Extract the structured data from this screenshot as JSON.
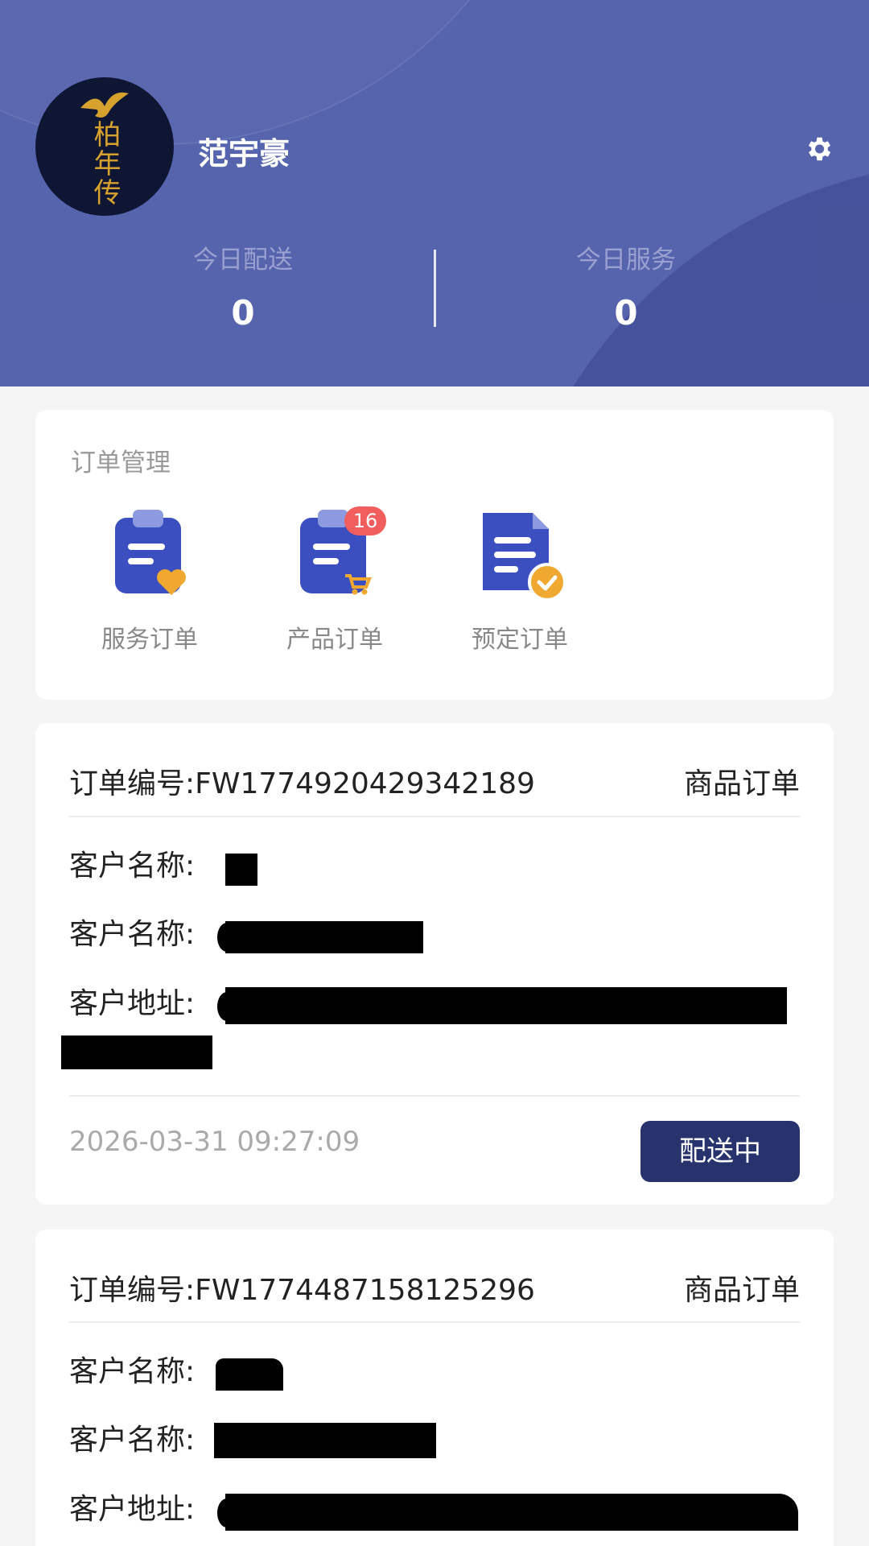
{
  "profile": {
    "name": "范宇豪",
    "avatar_text": "柏年传",
    "settings_icon": "gear-icon"
  },
  "stats": [
    {
      "label": "今日配送",
      "value": "0"
    },
    {
      "label": "今日服务",
      "value": "0"
    }
  ],
  "order_management": {
    "title": "订单管理",
    "items": [
      {
        "label": "服务订单",
        "icon": "service-order-icon"
      },
      {
        "label": "产品订单",
        "icon": "product-order-icon",
        "badge": "16"
      },
      {
        "label": "预定订单",
        "icon": "reserve-order-icon"
      }
    ]
  },
  "orders": [
    {
      "number_label": "订单编号:",
      "number": "FW1774920429342189",
      "type": "商品订单",
      "fields": [
        "客户名称:",
        "客户名称:",
        "客户地址:"
      ],
      "time": "2026-03-31 09:27:09",
      "status": "配送中"
    },
    {
      "number_label": "订单编号:",
      "number": "FW1774487158125296",
      "type": "商品订单",
      "fields": [
        "客户名称:",
        "客户名称:",
        "客户地址:"
      ]
    }
  ],
  "colors": {
    "header_bg": "#5664ae",
    "status_btn": "#28336e",
    "badge": "#f25d5d",
    "icon_blue": "#3b4fc0",
    "icon_accent": "#f0a830"
  }
}
